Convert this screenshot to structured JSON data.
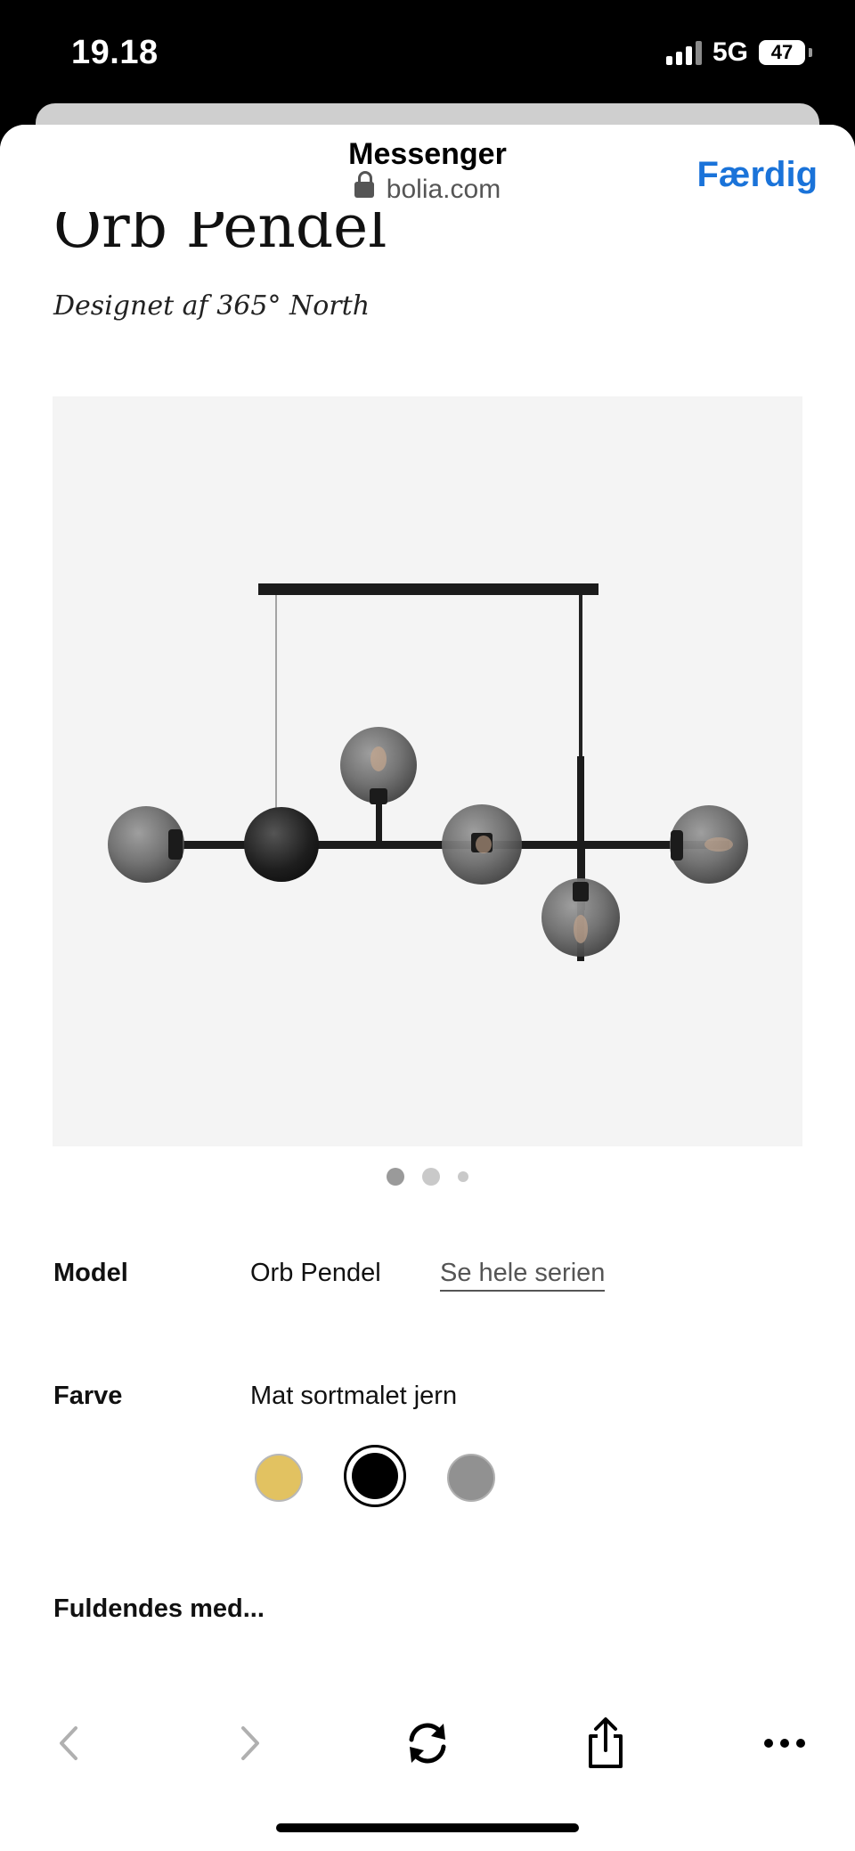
{
  "status_bar": {
    "time": "19.18",
    "network": "5G",
    "battery": "47"
  },
  "browser": {
    "title": "Messenger",
    "url": "bolia.com",
    "done_label": "Færdig"
  },
  "product": {
    "title": "Orb Pendel",
    "designer": "Designet af 365° North",
    "image_alt": "Orb Pendel lamp",
    "carousel": {
      "pages": 3,
      "active": 1
    },
    "model": {
      "label": "Model",
      "value": "Orb Pendel",
      "series_link": "Se hele serien"
    },
    "color": {
      "label": "Farve",
      "value": "Mat sortmalet jern",
      "swatches": [
        {
          "name": "gold",
          "hex": "#e2c261"
        },
        {
          "name": "black",
          "hex": "#000000",
          "selected": true
        },
        {
          "name": "grey",
          "hex": "#919191"
        }
      ]
    },
    "completes_with": {
      "heading": "Fuldendes med..."
    }
  },
  "toolbar": {
    "icons": [
      "back-icon",
      "forward-icon",
      "reload-icon",
      "share-icon",
      "more-icon"
    ]
  },
  "colors": {
    "accent": "#1a73d9",
    "image_bg": "#f4f4f4"
  }
}
